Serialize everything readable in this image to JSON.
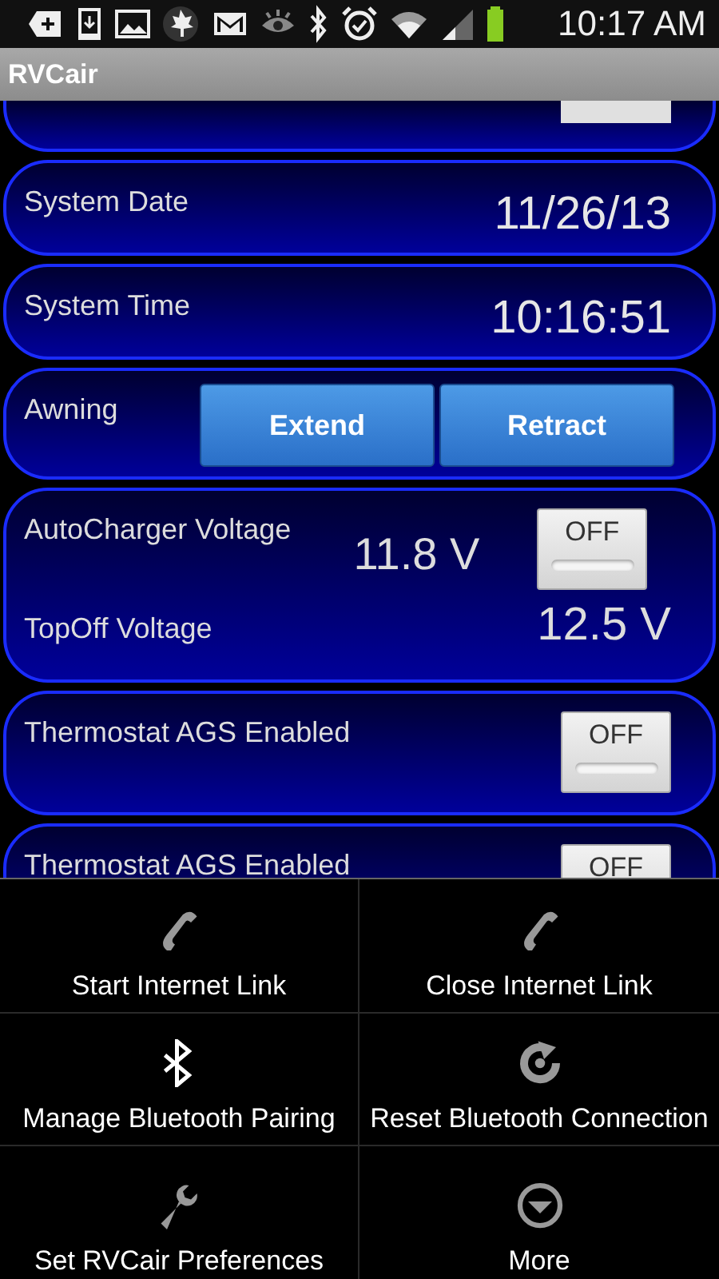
{
  "status_bar": {
    "time": "10:17 AM"
  },
  "app_bar": {
    "title": "RVCair"
  },
  "cards": [
    {
      "kind": "cut"
    },
    {
      "kind": "value",
      "label": "System Date",
      "value": "11/26/13"
    },
    {
      "kind": "value",
      "label": "System Time",
      "value": "10:16:51"
    },
    {
      "kind": "buttons",
      "label": "Awning",
      "buttons": [
        "Extend",
        "Retract"
      ]
    },
    {
      "kind": "voltages",
      "label": "AutoCharger Voltage",
      "value": "11.8 V",
      "toggle": {
        "label": "OFF",
        "on": false
      },
      "label2": "TopOff Voltage",
      "value2": "12.5 V"
    },
    {
      "kind": "toggle",
      "label": "Thermostat AGS Enabled",
      "toggle": {
        "label": "OFF",
        "on": false
      }
    },
    {
      "kind": "toggle",
      "label": "Thermostat AGS Enabled",
      "toggle": {
        "label": "OFF"
      }
    }
  ],
  "menu": [
    {
      "label": "Start Internet Link"
    },
    {
      "label": "Close Internet Link"
    },
    {
      "label": "Manage Bluetooth Pairing"
    },
    {
      "label": "Reset Bluetooth Connection"
    },
    {
      "label": "Set RVCair Preferences"
    },
    {
      "label": "More"
    }
  ]
}
